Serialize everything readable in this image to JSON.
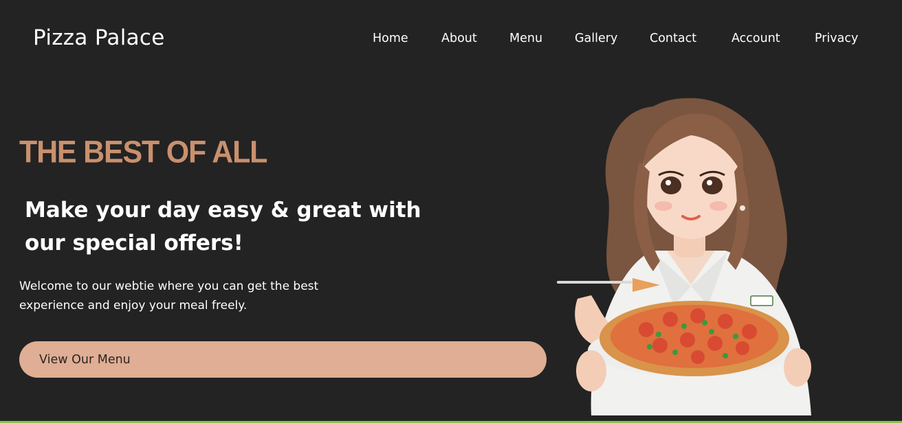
{
  "header": {
    "brand": "Pizza Palace",
    "nav": [
      "Home",
      "About",
      "Menu",
      "Gallery",
      "Contact",
      "Account",
      "Privacy"
    ]
  },
  "hero": {
    "tagline": "THE BEST OF ALL",
    "headline": "Make your day easy & great with our special offers!",
    "lead": "Welcome to our webtie where you can get the best experience and enjoy your meal freely.",
    "cta_label": "View Our Menu",
    "illustration_icon": "chef-woman-with-pizza-illustration"
  },
  "colors": {
    "background": "#232323",
    "accent": "#c9906e",
    "button": "#dfae94",
    "button_text": "#2a2522",
    "bottom_border": "#8bc34a"
  }
}
